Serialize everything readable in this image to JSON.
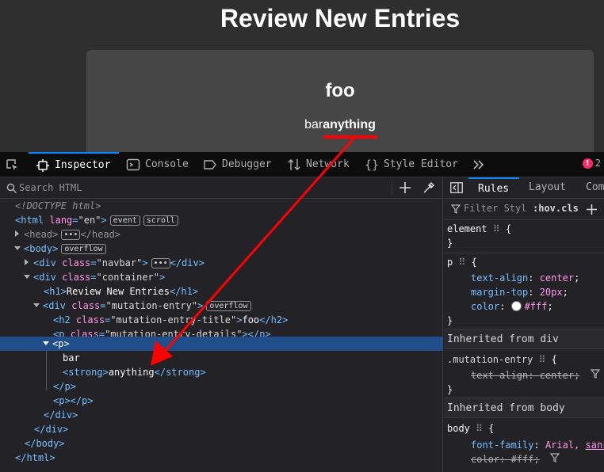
{
  "page": {
    "title": "Review New Entries",
    "entry_title": "foo",
    "entry_text_plain": "bar",
    "entry_text_strong": "anything"
  },
  "toolbar": {
    "pick_tooltip": "Pick an element from the page",
    "tabs": [
      {
        "label": "Inspector",
        "icon": "inspector-icon",
        "active": true
      },
      {
        "label": "Console",
        "icon": "console-icon",
        "active": false
      },
      {
        "label": "Debugger",
        "icon": "debugger-icon",
        "active": false
      },
      {
        "label": "Network",
        "icon": "network-icon",
        "active": false
      },
      {
        "label": "Style Editor",
        "icon": "style-editor-icon",
        "active": false
      }
    ],
    "overflow_icon": "chevron-double-right-icon",
    "error_count": "2"
  },
  "markup": {
    "search_placeholder": "Search HTML",
    "lines": {
      "doctype": "<!DOCTYPE html>",
      "html_tag": "html",
      "html_attr": "lang",
      "html_val": "\"en\"",
      "badge_event": "event",
      "badge_scroll": "scroll",
      "head_tag": "head",
      "body_tag": "body",
      "badge_overflow": "overflow",
      "div_tag": "div",
      "class_attr": "class",
      "navbar_val": "\"navbar\"",
      "container_val": "\"container\"",
      "h1_tag": "h1",
      "h1_text": "Review New Entries",
      "mutation_entry_val": "\"mutation-entry\"",
      "h2_tag": "h2",
      "entry_title_val": "\"mutation-entry-title\"",
      "h2_text": "foo",
      "p_tag": "p",
      "entry_details_val": "\"mutation-entry-details\"",
      "bar_text": "bar",
      "strong_tag": "strong",
      "strong_text": "anything"
    }
  },
  "rules": {
    "tabs": [
      {
        "label": "Rules",
        "active": true
      },
      {
        "label": "Layout",
        "active": false
      },
      {
        "label": "Com",
        "active": false
      }
    ],
    "filter_placeholder": "Filter Styl",
    "hov_cls": ":hov.cls",
    "element_selector": "element",
    "p_selector": "p",
    "p_props": [
      {
        "name": "text-align",
        "value": "center"
      },
      {
        "name": "margin-top",
        "value": "20px"
      },
      {
        "name": "color",
        "value": "#fff"
      }
    ],
    "inherited_div": "Inherited from div",
    "mutation_selector": ".mutation-entry",
    "mutation_prop": {
      "name": "text-align",
      "value": "center"
    },
    "inherited_body": "Inherited from body",
    "body_selector": "body",
    "body_font_prop": {
      "name": "font-family",
      "value1": "Arial,",
      "value2": "sans"
    },
    "body_color_prop": {
      "name": "color",
      "value": "#fff"
    }
  },
  "annotation": {
    "color": "#ff0000"
  }
}
